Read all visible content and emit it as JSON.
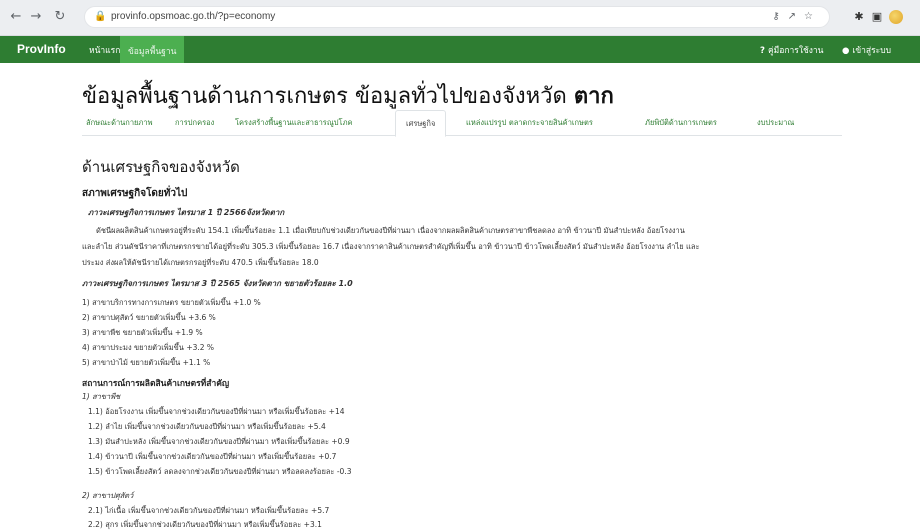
{
  "browser": {
    "url": "provinfo.opsmoac.go.th/?p=economy"
  },
  "navbar": {
    "brand": "ProvInfo",
    "items": [
      "หน้าแรก",
      "ข้อมูลพื้นฐาน"
    ],
    "manual": "คู่มือการใช้งาน",
    "login": "เข้าสู่ระบบ"
  },
  "page": {
    "title": "ข้อมูลพื้นฐานด้านการเกษตร ข้อมูลทั่วไปของจังหวัด",
    "province": "ตาก"
  },
  "tabs": [
    "ลักษณะด้านกายภาพ",
    "การปกครอง",
    "โครงสร้างพื้นฐานและสาธารณูปโภค",
    "เศรษฐกิจ",
    "แหล่งแปรรูป ตลาดกระจายสินค้าเกษตร",
    "ภัยพิบัติด้านการเกษตร",
    "งบประมาณ"
  ],
  "content": {
    "heading": "ด้านเศรษฐกิจของจังหวัด",
    "subheading": "สภาพเศรษฐกิจโดยทั่วไป",
    "q1_title": "ภาวะเศรษฐกิจการเกษตร ไตรมาส 1 ปี 2566จังหวัดตาก",
    "para_line1": "ดัชนีผลผลิตสินค้าเกษตรอยู่ที่ระดับ 154.1 เพิ่มขึ้นร้อยละ 1.1 เมื่อเทียบกับช่วงเดียวกันของปีที่ผ่านมา เนื่องจากผลผลิตสินค้าเกษตรสาขาพืชลดลง อาทิ ข้าวนาปี มันสำปะหลัง อ้อยโรงงาน",
    "para_line2": "และลำไย ส่วนดัชนีราคาที่เกษตรกรขายได้อยู่ที่ระดับ 305.3 เพิ่มขึ้นร้อยละ 16.7 เนื่องจากราคาสินค้าเกษตรสำคัญที่เพิ่มขึ้น อาทิ ข้าวนาปี ข้าวโพดเลี้ยงสัตว์ มันสำปะหลัง อ้อยโรงงาน ลำไย และ",
    "para_line3": "ประมง ส่งผลให้ดัชนีรายได้เกษตรกรอยู่ที่ระดับ 470.5 เพิ่มขึ้นร้อยละ 18.0",
    "q3_title": "ภาวะเศรษฐกิจการเกษตร ไตรมาส 3 ปี 2565 จังหวัดตาก ขยายตัวร้อยละ 1.0",
    "q3_items": [
      "1) สาขาบริการทางการเกษตร ขยายตัวเพิ่มขึ้น +1.0 %",
      "2) สาขาปศุสัตว์ ขยายตัวเพิ่มขึ้น +3.6 %",
      "3) สาขาพืช ขยายตัวเพิ่มขึ้น +1.9 %",
      "4) สาขาประมง ขยายตัวเพิ่มขึ้น +3.2 %",
      "5) สาขาป่าไม้ ขยายตัวเพิ่มขึ้น +1.1 %"
    ],
    "production_title": "สถานการณ์การผลิตสินค้าเกษตรที่สำคัญ",
    "crops_title": "1) สาขาพืช",
    "crops_items": [
      "1.1) อ้อยโรงงาน เพิ่มขึ้นจากช่วงเดียวกันของปีที่ผ่านมา หรือเพิ่มขึ้นร้อยละ +14",
      "1.2) ลำไย เพิ่มขึ้นจากช่วงเดียวกันของปีที่ผ่านมา หรือเพิ่มขึ้นร้อยละ +5.4",
      "1.3) มันสำปะหลัง เพิ่มขึ้นจากช่วงเดียวกันของปีที่ผ่านมา หรือเพิ่มขึ้นร้อยละ +0.9",
      "1.4) ข้าวนาปี เพิ่มขึ้นจากช่วงเดียวกันของปีที่ผ่านมา หรือเพิ่มขึ้นร้อยละ +0.7",
      "1.5) ข้าวโพดเลี้ยงสัตว์ ลดลงจากช่วงเดียวกันของปีที่ผ่านมา หรือลดลงร้อยละ -0.3"
    ],
    "livestock_title": "2) สาขาปศุสัตว์",
    "livestock_items": [
      "2.1) ไก่เนื้อ เพิ่มขึ้นจากช่วงเดียวกันของปีที่ผ่านมา หรือเพิ่มขึ้นร้อยละ +5.7",
      "2.2) สุกร เพิ่มขึ้นจากช่วงเดียวกันของปีที่ผ่านมา หรือเพิ่มขึ้นร้อยละ +3.1"
    ]
  },
  "colors": {
    "navbar": "#2e7d32",
    "navbar_active": "#4caf50",
    "tab_link": "#2e7d32"
  }
}
